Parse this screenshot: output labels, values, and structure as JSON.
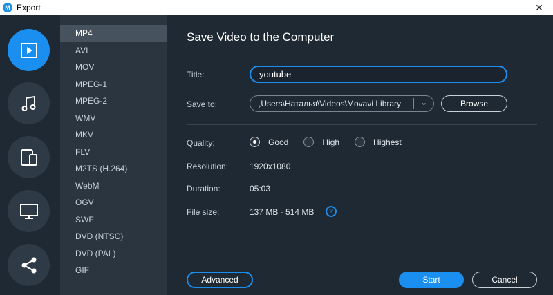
{
  "window": {
    "title": "Export",
    "app_icon_glyph": "M"
  },
  "rail": {
    "items": [
      {
        "name": "video-export",
        "icon": "video-icon",
        "active": true
      },
      {
        "name": "audio-export",
        "icon": "music-note-icon",
        "active": false
      },
      {
        "name": "devices-export",
        "icon": "devices-icon",
        "active": false
      },
      {
        "name": "tv-export",
        "icon": "monitor-icon",
        "active": false
      },
      {
        "name": "share-export",
        "icon": "share-icon",
        "active": false
      }
    ]
  },
  "formats": {
    "selected": "MP4",
    "items": [
      "MP4",
      "AVI",
      "MOV",
      "MPEG-1",
      "MPEG-2",
      "WMV",
      "MKV",
      "FLV",
      "M2TS (H.264)",
      "WebM",
      "OGV",
      "SWF",
      "DVD (NTSC)",
      "DVD (PAL)",
      "GIF"
    ]
  },
  "main": {
    "heading": "Save Video to the Computer",
    "title_label": "Title:",
    "title_value": "youtube",
    "save_to_label": "Save to:",
    "save_to_path": ",Users\\Наталья\\Videos\\Movavi Library",
    "browse_label": "Browse",
    "quality_label": "Quality:",
    "quality_options": [
      "Good",
      "High",
      "Highest"
    ],
    "quality_selected": "Good",
    "resolution_label": "Resolution:",
    "resolution_value": "1920x1080",
    "duration_label": "Duration:",
    "duration_value": "05:03",
    "file_size_label": "File size:",
    "file_size_value": "137 MB - 514 MB",
    "help_glyph": "?",
    "advanced_label": "Advanced",
    "start_label": "Start",
    "cancel_label": "Cancel"
  },
  "colors": {
    "accent": "#1a8ff0",
    "background": "#1f2933",
    "list_background": "#2b3540"
  }
}
